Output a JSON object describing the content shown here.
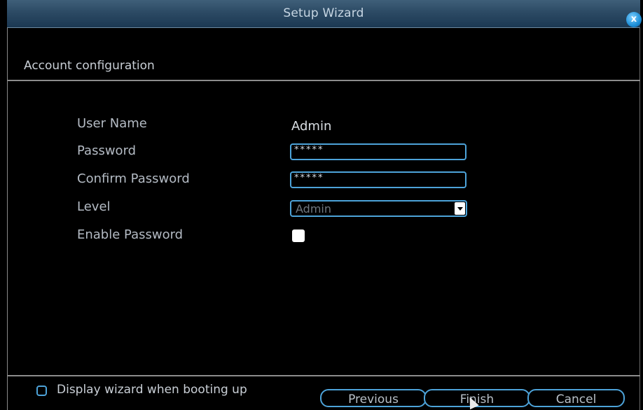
{
  "window": {
    "title": "Setup Wizard",
    "close_label": "x"
  },
  "section": {
    "title": "Account configuration"
  },
  "form": {
    "username_label": "User Name",
    "username_value": "Admin",
    "password_label": "Password",
    "password_value": "*****",
    "confirm_label": "Confirm Password",
    "confirm_value": "*****",
    "level_label": "Level",
    "level_value": "Admin",
    "enable_label": "Enable Password",
    "enable_checked": false
  },
  "footer": {
    "boot_label": "Display wizard when booting up",
    "boot_checked": false,
    "previous_label": "Previous",
    "finish_label": "Finish",
    "cancel_label": "Cancel"
  },
  "colors": {
    "accent": "#4da3d9",
    "titlebar": "#2c4a64",
    "background": "#000000"
  }
}
